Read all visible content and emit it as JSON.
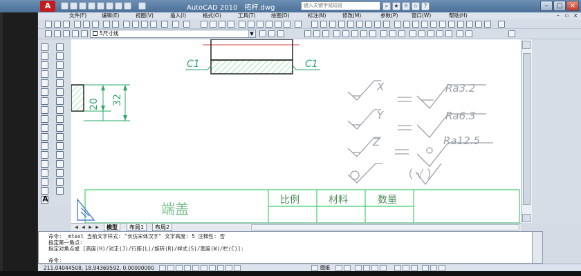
{
  "window": {
    "app_title": "AutoCAD 2010",
    "document": "拓杆.dwg",
    "search_placeholder": "键入关键字或短语",
    "logo_letter": "A"
  },
  "menu": {
    "items": [
      "文件(F)",
      "编辑(E)",
      "视图(V)",
      "插入(I)",
      "格式(O)",
      "工具(T)",
      "绘图(D)",
      "标注(N)",
      "修改(M)",
      "参数(P)",
      "窗口(W)",
      "帮助(H)"
    ]
  },
  "layer": {
    "current": "5尺寸线"
  },
  "drawing": {
    "chamfer_left": "C1",
    "chamfer_right": "C1",
    "dim_20": "20",
    "dim_32": "32",
    "rough_x": "X",
    "rough_y": "Y",
    "rough_z": "Z",
    "ra1": "Ra3.2",
    "ra2": "Ra6.3",
    "ra3": "Ra12.5",
    "title_name": "端盖",
    "hdr_scale": "比例",
    "hdr_material": "材料",
    "hdr_qty": "数量",
    "paren_check": "（ √ ）"
  },
  "tabs": {
    "model": "模型",
    "layout1": "布局1",
    "layout2": "布局2"
  },
  "command": {
    "line1": "命令: _mtext 当前文字样式: \"长仿宋体汉字\" 文字高度: 5 注释性: 否",
    "line2": "指定第一角点:",
    "line3": "指定对角点或 [高度(H)/对正(J)/行距(L)/旋转(R)/样式(S)/宽度(W)/栏(C)]:",
    "line4": "命令:"
  },
  "status": {
    "coords": "211.04044508, 18.94369592, 0.00000000",
    "model_label": "图纸"
  },
  "colors": {
    "dim_green": "#2aa86a",
    "table_green": "#3fcf6a",
    "hatch_green": "#5fd97d",
    "red_line": "#d84040"
  }
}
